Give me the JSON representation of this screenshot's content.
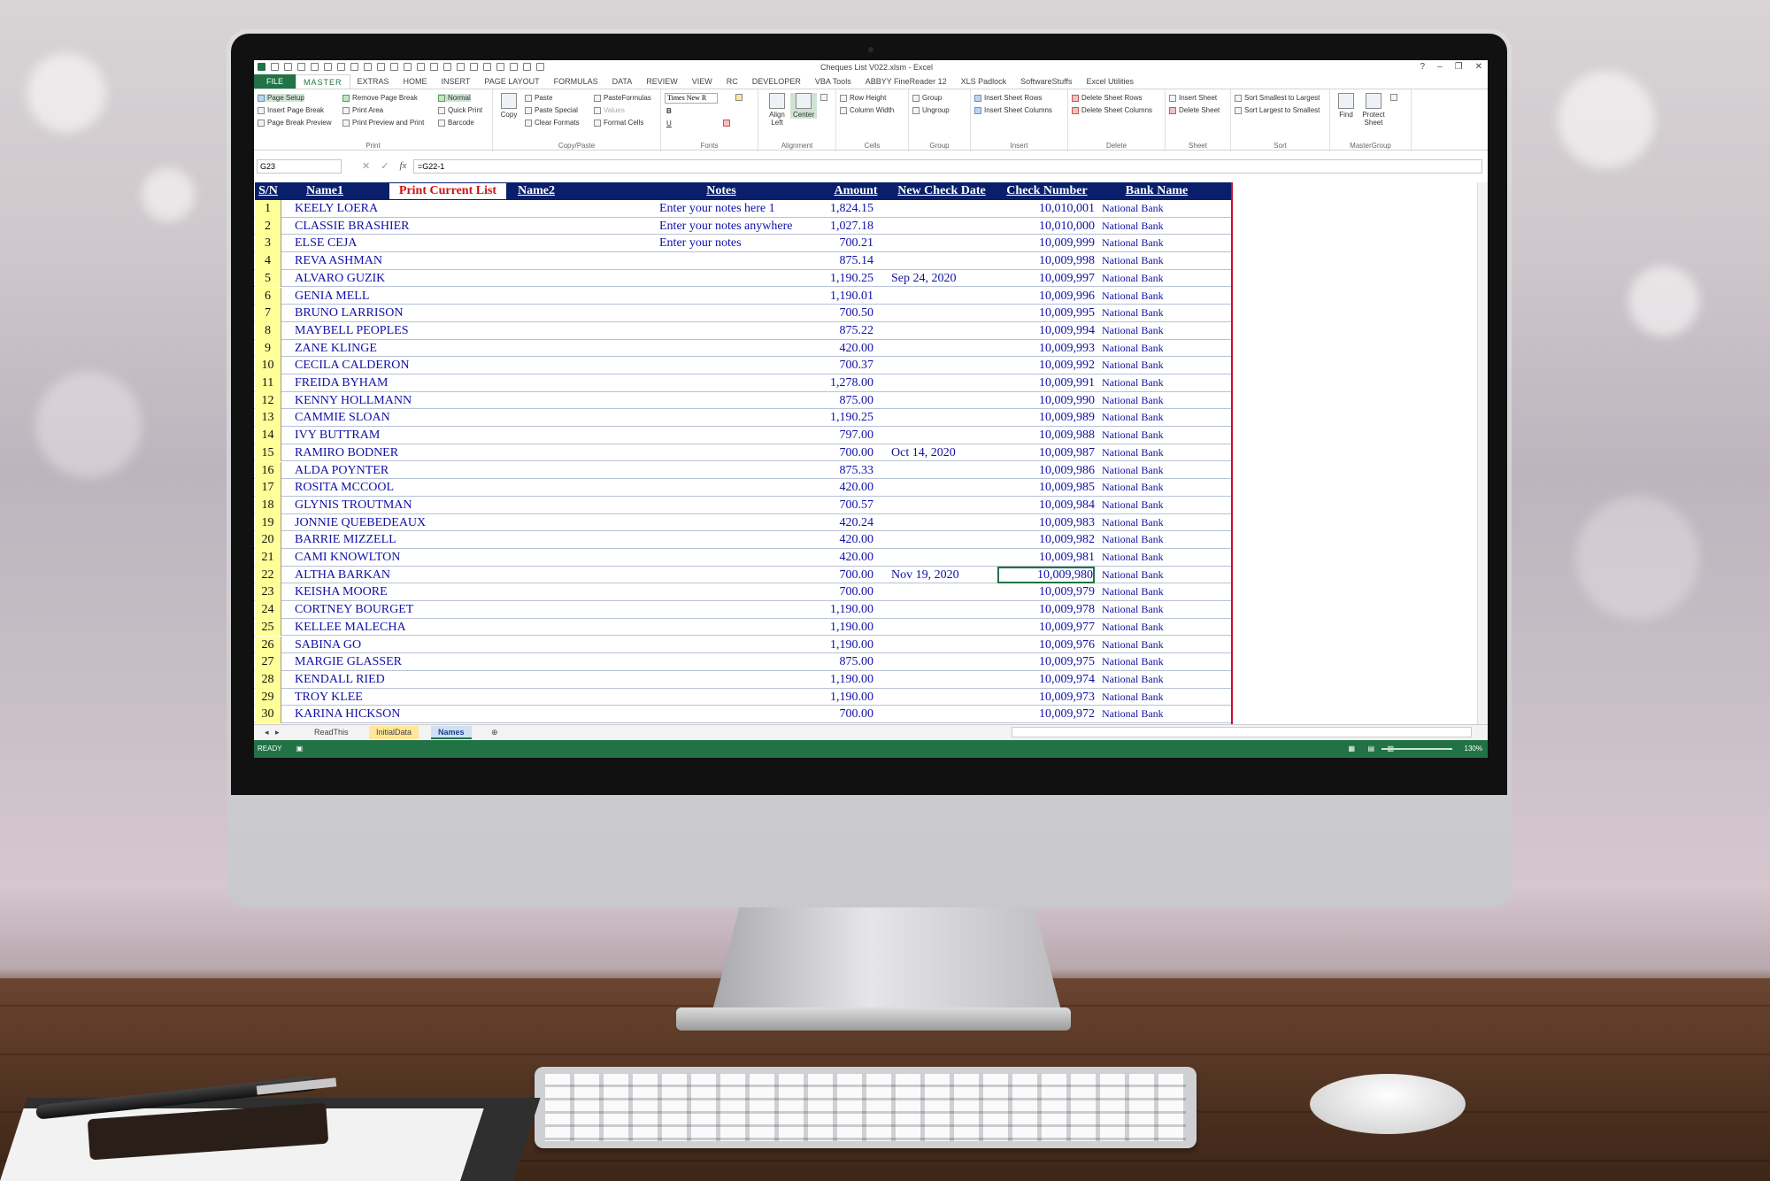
{
  "window": {
    "title": "Cheques List V022.xlsm - Excel",
    "controls": [
      "?",
      "–",
      "❐",
      "✕"
    ]
  },
  "ribbon_tabs": [
    "FILE",
    "MASTER",
    "EXTRAS",
    "HOME",
    "INSERT",
    "PAGE LAYOUT",
    "FORMULAS",
    "DATA",
    "REVIEW",
    "VIEW",
    "RC",
    "DEVELOPER",
    "VBA Tools",
    "ABBYY FineReader 12",
    "XLS Padlock",
    "SoftwareStuffs",
    "Excel Utilities"
  ],
  "ribbon": {
    "print": {
      "label": "Print",
      "items": [
        "Page Setup",
        "Insert Page Break",
        "Page Break Preview",
        "Remove Page Break",
        "Print Area",
        "Print Preview and Print",
        "Normal",
        "Quick Print",
        "Barcode"
      ]
    },
    "copypaste": {
      "label": "Copy/Paste",
      "copy": "Copy",
      "items": [
        "Paste",
        "Paste Special",
        "Clear Formats",
        "PasteFormulas",
        "Values",
        "Format Cells"
      ]
    },
    "fonts": {
      "label": "Fonts",
      "font_name": "Times New R",
      "bold": "B",
      "underline": "U"
    },
    "alignment": {
      "label": "Alignment",
      "left": "Align Left",
      "center": "Center"
    },
    "cells": {
      "label": "Cells",
      "items": [
        "Row Height",
        "Column Width"
      ]
    },
    "group": {
      "label": "Group",
      "items": [
        "Group",
        "Ungroup"
      ]
    },
    "insert": {
      "label": "Insert",
      "items": [
        "Insert Sheet Rows",
        "Insert Sheet Columns"
      ]
    },
    "delete": {
      "label": "Delete",
      "items": [
        "Delete Sheet Rows",
        "Delete Sheet Columns"
      ]
    },
    "sheet": {
      "label": "Sheet",
      "items": [
        "Insert Sheet",
        "Delete Sheet"
      ]
    },
    "sort": {
      "label": "Sort",
      "items": [
        "Sort Smallest to Largest",
        "Sort Largest to Smallest"
      ]
    },
    "mastergroup": {
      "label": "MasterGroup",
      "find": "Find",
      "protect": "Protect Sheet"
    }
  },
  "formula_bar": {
    "name_box": "G23",
    "formula": "=G22-1"
  },
  "sheet": {
    "headers": {
      "sn": "S/N",
      "name1": "Name1",
      "print_button": "Print Current List",
      "name2": "Name2",
      "notes": "Notes",
      "amount": "Amount",
      "new_check_date": "New Check Date",
      "check_number": "Check Number",
      "bank_name": "Bank Name"
    },
    "rows": [
      {
        "sn": "1",
        "name": "KEELY LOERA",
        "notes": "Enter your notes here 1",
        "amount": "1,824.15",
        "date": "",
        "check": "10,010,001",
        "bank": "National Bank"
      },
      {
        "sn": "2",
        "name": "CLASSIE BRASHIER",
        "notes": "Enter your notes anywhere",
        "amount": "1,027.18",
        "date": "",
        "check": "10,010,000",
        "bank": "National Bank"
      },
      {
        "sn": "3",
        "name": "ELSE CEJA",
        "notes": "Enter your notes",
        "amount": "700.21",
        "date": "",
        "check": "10,009,999",
        "bank": "National Bank"
      },
      {
        "sn": "4",
        "name": "REVA ASHMAN",
        "notes": "",
        "amount": "875.14",
        "date": "",
        "check": "10,009,998",
        "bank": "National Bank"
      },
      {
        "sn": "5",
        "name": "ALVARO GUZIK",
        "notes": "",
        "amount": "1,190.25",
        "date": "Sep 24, 2020",
        "check": "10,009,997",
        "bank": "National Bank"
      },
      {
        "sn": "6",
        "name": "GENIA MELL",
        "notes": "",
        "amount": "1,190.01",
        "date": "",
        "check": "10,009,996",
        "bank": "National Bank"
      },
      {
        "sn": "7",
        "name": "BRUNO LARRISON",
        "notes": "",
        "amount": "700.50",
        "date": "",
        "check": "10,009,995",
        "bank": "National Bank"
      },
      {
        "sn": "8",
        "name": "MAYBELL PEOPLES",
        "notes": "",
        "amount": "875.22",
        "date": "",
        "check": "10,009,994",
        "bank": "National Bank"
      },
      {
        "sn": "9",
        "name": "ZANE KLINGE",
        "notes": "",
        "amount": "420.00",
        "date": "",
        "check": "10,009,993",
        "bank": "National Bank"
      },
      {
        "sn": "10",
        "name": "CECILA CALDERON",
        "notes": "",
        "amount": "700.37",
        "date": "",
        "check": "10,009,992",
        "bank": "National Bank"
      },
      {
        "sn": "11",
        "name": "FREIDA BYHAM",
        "notes": "",
        "amount": "1,278.00",
        "date": "",
        "check": "10,009,991",
        "bank": "National Bank"
      },
      {
        "sn": "12",
        "name": "KENNY HOLLMANN",
        "notes": "",
        "amount": "875.00",
        "date": "",
        "check": "10,009,990",
        "bank": "National Bank"
      },
      {
        "sn": "13",
        "name": "CAMMIE SLOAN",
        "notes": "",
        "amount": "1,190.25",
        "date": "",
        "check": "10,009,989",
        "bank": "National Bank"
      },
      {
        "sn": "14",
        "name": "IVY BUTTRAM",
        "notes": "",
        "amount": "797.00",
        "date": "",
        "check": "10,009,988",
        "bank": "National Bank"
      },
      {
        "sn": "15",
        "name": "RAMIRO BODNER",
        "notes": "",
        "amount": "700.00",
        "date": "Oct 14, 2020",
        "check": "10,009,987",
        "bank": "National Bank"
      },
      {
        "sn": "16",
        "name": "ALDA POYNTER",
        "notes": "",
        "amount": "875.33",
        "date": "",
        "check": "10,009,986",
        "bank": "National Bank"
      },
      {
        "sn": "17",
        "name": "ROSITA MCCOOL",
        "notes": "",
        "amount": "420.00",
        "date": "",
        "check": "10,009,985",
        "bank": "National Bank"
      },
      {
        "sn": "18",
        "name": "GLYNIS TROUTMAN",
        "notes": "",
        "amount": "700.57",
        "date": "",
        "check": "10,009,984",
        "bank": "National Bank"
      },
      {
        "sn": "19",
        "name": "JONNIE QUEBEDEAUX",
        "notes": "",
        "amount": "420.24",
        "date": "",
        "check": "10,009,983",
        "bank": "National Bank"
      },
      {
        "sn": "20",
        "name": "BARRIE MIZZELL",
        "notes": "",
        "amount": "420.00",
        "date": "",
        "check": "10,009,982",
        "bank": "National Bank"
      },
      {
        "sn": "21",
        "name": "CAMI KNOWLTON",
        "notes": "",
        "amount": "420.00",
        "date": "",
        "check": "10,009,981",
        "bank": "National Bank"
      },
      {
        "sn": "22",
        "name": "ALTHA BARKAN",
        "notes": "",
        "amount": "700.00",
        "date": "Nov 19, 2020",
        "check": "10,009,980",
        "bank": "National Bank"
      },
      {
        "sn": "23",
        "name": "KEISHA MOORE",
        "notes": "",
        "amount": "700.00",
        "date": "",
        "check": "10,009,979",
        "bank": "National Bank"
      },
      {
        "sn": "24",
        "name": "CORTNEY BOURGET",
        "notes": "",
        "amount": "1,190.00",
        "date": "",
        "check": "10,009,978",
        "bank": "National Bank"
      },
      {
        "sn": "25",
        "name": "KELLEE MALECHA",
        "notes": "",
        "amount": "1,190.00",
        "date": "",
        "check": "10,009,977",
        "bank": "National Bank"
      },
      {
        "sn": "26",
        "name": "SABINA GO",
        "notes": "",
        "amount": "1,190.00",
        "date": "",
        "check": "10,009,976",
        "bank": "National Bank"
      },
      {
        "sn": "27",
        "name": "MARGIE GLASSER",
        "notes": "",
        "amount": "875.00",
        "date": "",
        "check": "10,009,975",
        "bank": "National Bank"
      },
      {
        "sn": "28",
        "name": "KENDALL RIED",
        "notes": "",
        "amount": "1,190.00",
        "date": "",
        "check": "10,009,974",
        "bank": "National Bank"
      },
      {
        "sn": "29",
        "name": "TROY KLEE",
        "notes": "",
        "amount": "1,190.00",
        "date": "",
        "check": "10,009,973",
        "bank": "National Bank"
      },
      {
        "sn": "30",
        "name": "KARINA HICKSON",
        "notes": "",
        "amount": "700.00",
        "date": "",
        "check": "10,009,972",
        "bank": "National Bank"
      }
    ],
    "selected_row": 21
  },
  "sheet_tabs": [
    "ReadThis",
    "InitialData",
    "Names"
  ],
  "status": {
    "ready": "READY",
    "zoom": "130%"
  },
  "colors": {
    "header_bg": "#0a1f6b",
    "excel_green": "#217346",
    "sn_fill": "#ffff99",
    "text_blue": "#1010a8",
    "print_red": "#d01010"
  }
}
